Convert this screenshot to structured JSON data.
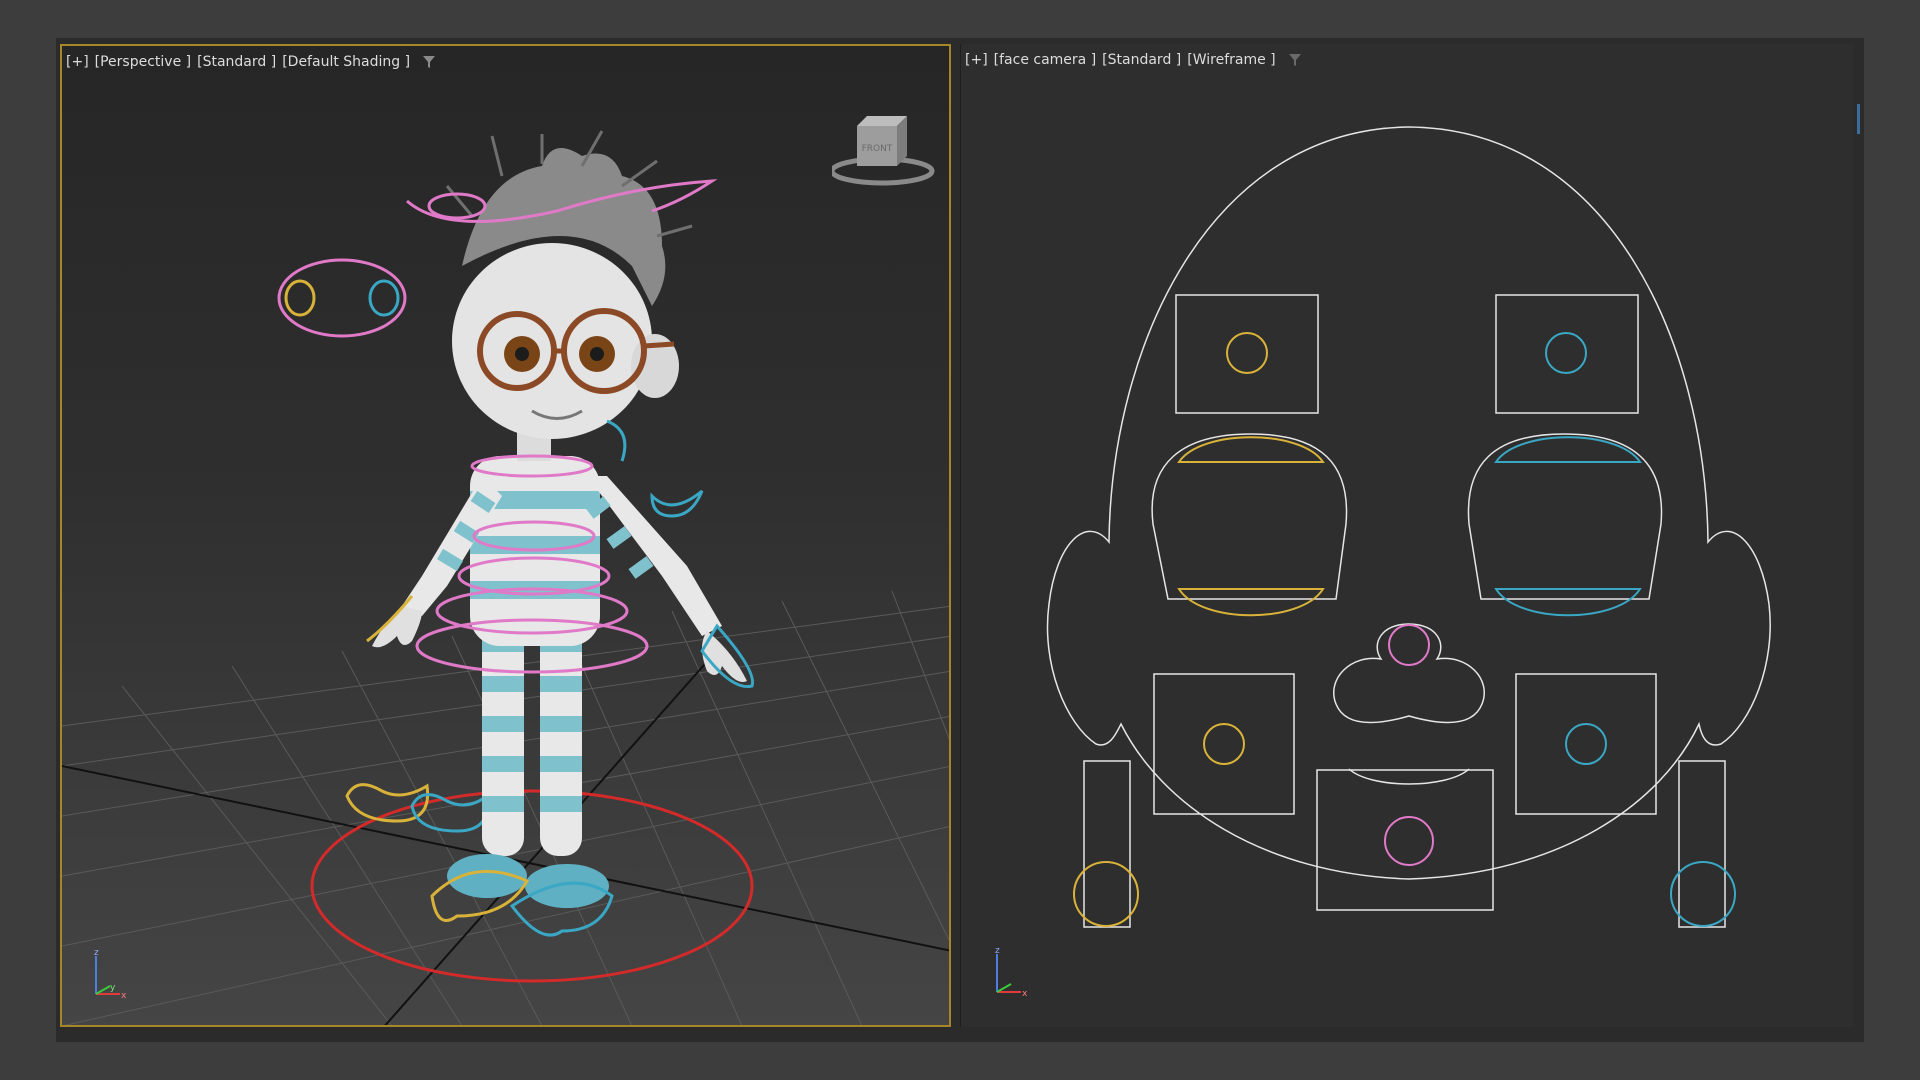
{
  "viewports": [
    {
      "id": "left",
      "label_parts": [
        "[+]",
        "[Perspective ]",
        "[Standard ]",
        "[Default Shading ]"
      ],
      "active": true
    },
    {
      "id": "right",
      "label_parts": [
        "[+]",
        "[face camera ]",
        "[Standard ]",
        "[Wireframe ]"
      ],
      "active": false
    }
  ],
  "viewcube": {
    "face_label": "FRONT"
  },
  "axis_gizmo": {
    "z": "z",
    "y": "y",
    "x": "x"
  },
  "colors": {
    "active_border": "#a78628",
    "control_yellow": "#d9b23a",
    "control_cyan": "#3aa7c4",
    "control_pink": "#e07ac8",
    "control_red": "#d42a2a",
    "wire_white": "#e6e6e6"
  }
}
